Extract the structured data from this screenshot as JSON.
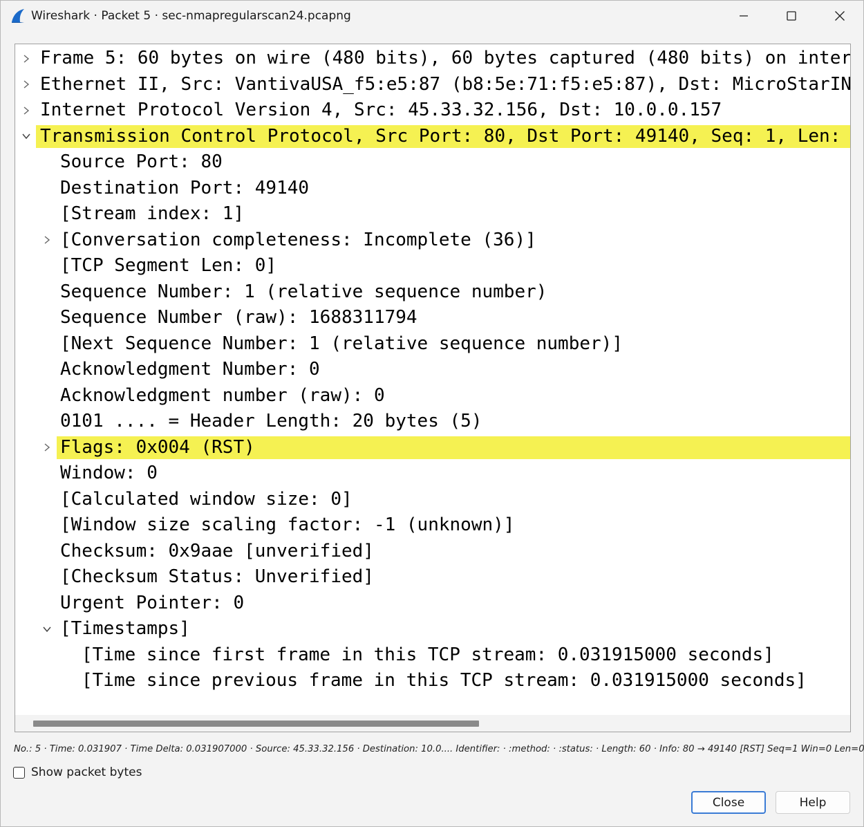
{
  "window": {
    "title": "Wireshark · Packet 5 · sec-nmapregularscan24.pcapng"
  },
  "colors": {
    "highlight": "#f5f152",
    "accent": "#3a7bd5"
  },
  "tree": {
    "rows": [
      {
        "text": "Frame 5: 60 bytes on wire (480 bits), 60 bytes captured (480 bits) on inter",
        "level": 0,
        "expander": "collapsed",
        "highlight": false
      },
      {
        "text": "Ethernet II, Src: VantivaUSA_f5:e5:87 (b8:5e:71:f5:e5:87), Dst: MicroStarIN",
        "level": 0,
        "expander": "collapsed",
        "highlight": false
      },
      {
        "text": "Internet Protocol Version 4, Src: 45.33.32.156, Dst: 10.0.0.157",
        "level": 0,
        "expander": "collapsed",
        "highlight": false
      },
      {
        "text": "Transmission Control Protocol, Src Port: 80, Dst Port: 49140, Seq: 1, Len:",
        "level": 0,
        "expander": "expanded",
        "highlight": true
      },
      {
        "text": "Source Port: 80",
        "level": 1,
        "expander": "none",
        "highlight": false
      },
      {
        "text": "Destination Port: 49140",
        "level": 1,
        "expander": "none",
        "highlight": false
      },
      {
        "text": "[Stream index: 1]",
        "level": 1,
        "expander": "none",
        "highlight": false
      },
      {
        "text": "[Conversation completeness: Incomplete (36)]",
        "level": 1,
        "expander": "collapsed",
        "highlight": false
      },
      {
        "text": "[TCP Segment Len: 0]",
        "level": 1,
        "expander": "none",
        "highlight": false
      },
      {
        "text": "Sequence Number: 1    (relative sequence number)",
        "level": 1,
        "expander": "none",
        "highlight": false
      },
      {
        "text": "Sequence Number (raw): 1688311794",
        "level": 1,
        "expander": "none",
        "highlight": false
      },
      {
        "text": "[Next Sequence Number: 1    (relative sequence number)]",
        "level": 1,
        "expander": "none",
        "highlight": false
      },
      {
        "text": "Acknowledgment Number: 0",
        "level": 1,
        "expander": "none",
        "highlight": false
      },
      {
        "text": "Acknowledgment number (raw): 0",
        "level": 1,
        "expander": "none",
        "highlight": false
      },
      {
        "text": "0101 .... = Header Length: 20 bytes (5)",
        "level": 1,
        "expander": "none",
        "highlight": false
      },
      {
        "text": "Flags: 0x004 (RST)",
        "level": 1,
        "expander": "collapsed",
        "highlight": true
      },
      {
        "text": "Window: 0",
        "level": 1,
        "expander": "none",
        "highlight": false
      },
      {
        "text": "[Calculated window size: 0]",
        "level": 1,
        "expander": "none",
        "highlight": false
      },
      {
        "text": "[Window size scaling factor: -1 (unknown)]",
        "level": 1,
        "expander": "none",
        "highlight": false
      },
      {
        "text": "Checksum: 0x9aae [unverified]",
        "level": 1,
        "expander": "none",
        "highlight": false
      },
      {
        "text": "[Checksum Status: Unverified]",
        "level": 1,
        "expander": "none",
        "highlight": false
      },
      {
        "text": "Urgent Pointer: 0",
        "level": 1,
        "expander": "none",
        "highlight": false
      },
      {
        "text": "[Timestamps]",
        "level": 1,
        "expander": "expanded",
        "highlight": false
      },
      {
        "text": "[Time since first frame in this TCP stream: 0.031915000 seconds]",
        "level": 2,
        "expander": "none",
        "highlight": false
      },
      {
        "text": "[Time since previous frame in this TCP stream: 0.031915000 seconds]",
        "level": 2,
        "expander": "none",
        "highlight": false
      }
    ]
  },
  "status": {
    "text": "No.: 5 · Time: 0.031907 · Time Delta: 0.031907000 · Source: 45.33.32.156 · Destination: 10.0.... Identifier: · :method: · :status: · Length: 60 · Info: 80 → 49140 [RST] Seq=1 Win=0 Len=0"
  },
  "footer": {
    "show_bytes_label": "Show packet bytes",
    "show_bytes_checked": false,
    "close_label": "Close",
    "help_label": "Help"
  }
}
